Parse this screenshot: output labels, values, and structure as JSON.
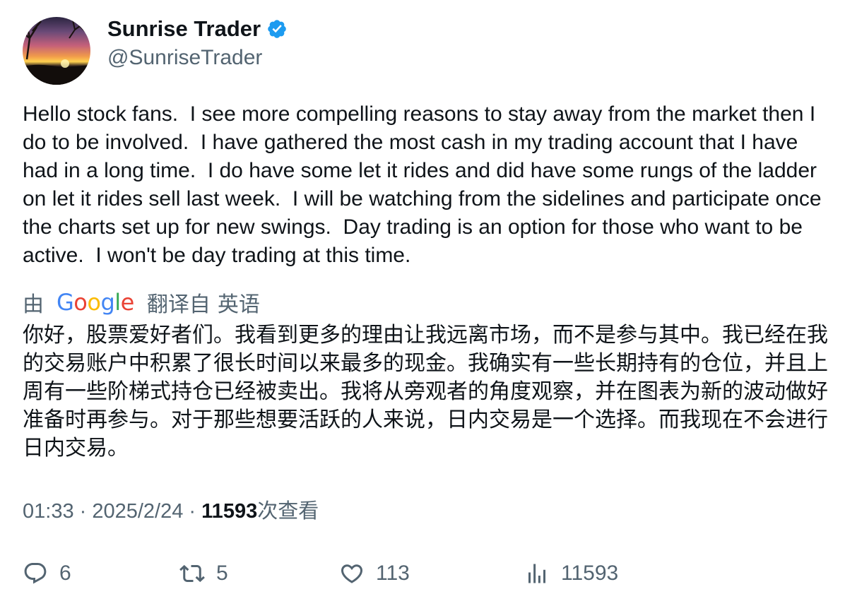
{
  "user": {
    "display_name": "Sunrise Trader",
    "handle": "@SunriseTrader",
    "verified": true,
    "avatar": "sunset-photo-avatar"
  },
  "tweet": {
    "text": "Hello stock fans.  I see more compelling reasons to stay away from the market then I do to be involved.  I have gathered the most cash in my trading account that I have had in a long time.  I do have some let it rides and did have some rungs of the ladder on let it rides sell last week.  I will be watching from the sidelines and participate once the charts set up for new swings.  Day trading is an option for those who want to be active.  I won't be day trading at this time."
  },
  "translation": {
    "prefix": "由",
    "provider": "Google",
    "suffix": "翻译自",
    "source_language": "英语",
    "text": "你好，股票爱好者们。我看到更多的理由让我远离市场，而不是参与其中。我已经在我的交易账户中积累了很长时间以来最多的现金。我确实有一些长期持有的仓位，并且上周有一些阶梯式持仓已经被卖出。我将从旁观者的角度观察，并在图表为新的波动做好准备时再参与。对于那些想要活跃的人来说，日内交易是一个选择。而我现在不会进行日内交易。"
  },
  "meta": {
    "time": "01:33",
    "separator": " · ",
    "date": "2025/2/24",
    "views_count": "11593",
    "views_label": "次查看"
  },
  "actions": {
    "replies": "6",
    "retweets": "5",
    "likes": "113",
    "views": "11593"
  },
  "colors": {
    "text_primary": "#0f1419",
    "text_secondary": "#536471",
    "verified_blue": "#1d9bf0"
  }
}
